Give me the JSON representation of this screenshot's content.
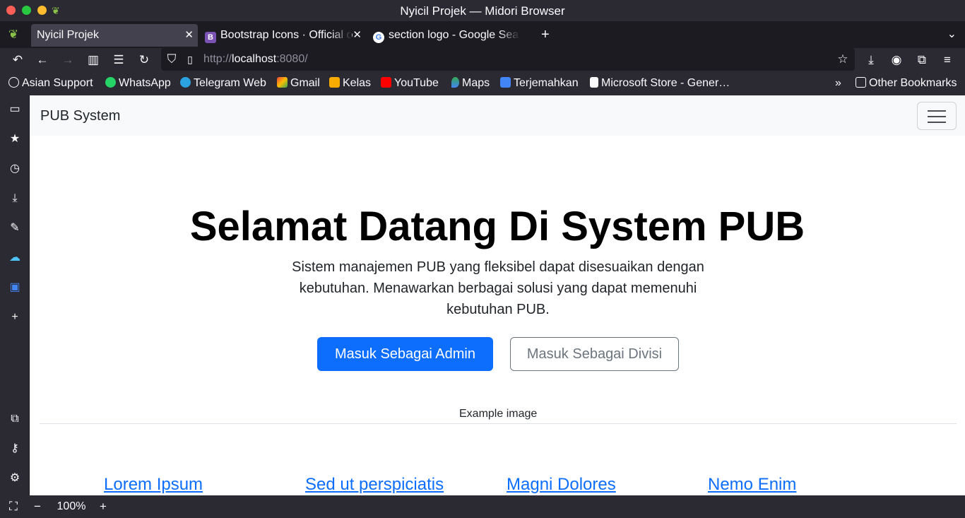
{
  "window": {
    "title": "Nyicil Projek — Midori Browser"
  },
  "tabs": [
    {
      "label": "Nyicil Projek",
      "active": true
    },
    {
      "label": "Bootstrap Icons · Official o",
      "active": false
    },
    {
      "label": "section logo - Google Sea",
      "active": false
    }
  ],
  "url": {
    "scheme": "http://",
    "host": "localhost",
    "rest": ":8080/"
  },
  "bookmarks": [
    {
      "label": "Asian Support",
      "icon": "globe-icon"
    },
    {
      "label": "WhatsApp",
      "icon": "whatsapp-icon"
    },
    {
      "label": "Telegram Web",
      "icon": "telegram-icon"
    },
    {
      "label": "Gmail",
      "icon": "gmail-icon"
    },
    {
      "label": "Kelas",
      "icon": "classroom-icon"
    },
    {
      "label": "YouTube",
      "icon": "youtube-icon"
    },
    {
      "label": "Maps",
      "icon": "maps-icon"
    },
    {
      "label": "Terjemahkan",
      "icon": "translate-icon"
    },
    {
      "label": "Microsoft Store - Gener…",
      "icon": "store-icon"
    }
  ],
  "other_bookmarks": "Other Bookmarks",
  "page": {
    "brand": "PUB System",
    "hero_title": "Selamat Datang Di System PUB",
    "hero_subtitle": "Sistem manajemen PUB yang fleksibel dapat disesuaikan dengan kebutuhan. Menawarkan berbagai solusi yang dapat memenuhi kebutuhan PUB.",
    "btn_admin": "Masuk Sebagai Admin",
    "btn_divisi": "Masuk Sebagai Divisi",
    "image_alt": "Example image",
    "links": [
      "Lorem Ipsum",
      "Sed ut perspiciatis",
      "Magni Dolores",
      "Nemo Enim"
    ]
  },
  "status": {
    "zoom": "100%"
  },
  "colors": {
    "primary": "#0d6efd",
    "secondary": "#6c757d",
    "chrome": "#2b2a33"
  }
}
